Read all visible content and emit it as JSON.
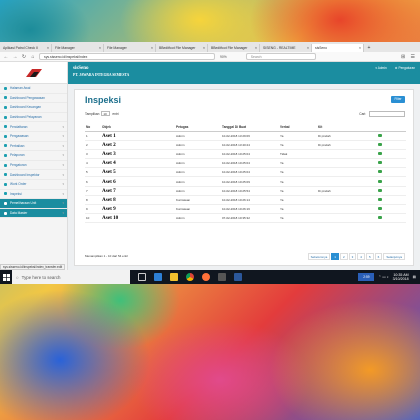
{
  "browser": {
    "tabs": [
      {
        "label": "Aplikasi Patrol Check II"
      },
      {
        "label": "File Manager"
      },
      {
        "label": "File Manager"
      },
      {
        "label": "BBeditfoot File Manager"
      },
      {
        "label": "BBeditfoot File Manager"
      },
      {
        "label": "SISENG - REALTIME"
      },
      {
        "label": "sisSeno"
      }
    ],
    "url": "sys.sisseno.id/inspeksi/index",
    "zoom": "90%",
    "search_placeholder": "Search",
    "status_url": "sys.sisseno.id/inspeksi/index_transfer.edit"
  },
  "app": {
    "brand": "sisSeno",
    "company": "PT. JAWARA INTEGRA SEMESTA",
    "top_right": {
      "notif": "Admin",
      "settings": "Pengaturan"
    }
  },
  "sidebar": {
    "items": [
      {
        "label": "Halaman Awal",
        "active": false
      },
      {
        "label": "Dashboard Pengawasan",
        "active": false
      },
      {
        "label": "Dashboard Keuangan",
        "active": false
      },
      {
        "label": "Dashboard Pelayanan",
        "active": false
      },
      {
        "label": "Pendaftaran",
        "active": false
      },
      {
        "label": "Pengawasan",
        "active": false
      },
      {
        "label": "Perbaikan",
        "active": false
      },
      {
        "label": "Pelaporan",
        "active": false
      },
      {
        "label": "Pengaturan",
        "active": false
      },
      {
        "label": "Dashboard Inspektor",
        "active": false
      },
      {
        "label": "Work Order",
        "active": false
      },
      {
        "label": "Inspeksi",
        "active": false
      },
      {
        "label": "Pemeliharaan Unit",
        "active": true
      },
      {
        "label": "Data Master",
        "active": false
      }
    ]
  },
  "page": {
    "title": "Inspeksi",
    "filter_label": "Filter",
    "show_label": "Tampilkan",
    "show_value": "10",
    "entries_label": "entri",
    "search_label": "Cari:",
    "columns": [
      "No",
      "Objek",
      "Petugas",
      "Tanggal Di Buat",
      "Verbal",
      "Kit",
      ""
    ],
    "rows": [
      {
        "no": "1",
        "asset": "Aset 1",
        "petugas": "Admin",
        "tanggal": "10-02-2018 13:29:06",
        "verbal": "Ya",
        "kit": "Di pindah"
      },
      {
        "no": "2",
        "asset": "Aset 2",
        "petugas": "Admin",
        "tanggal": "10-02-2018 13:40:24",
        "verbal": "Ya",
        "kit": "Di pindah"
      },
      {
        "no": "3",
        "asset": "Aset 3",
        "petugas": "Admin",
        "tanggal": "10-02-2018 10:25:04",
        "verbal": "Tidak",
        "kit": ""
      },
      {
        "no": "4",
        "asset": "Aset 4",
        "petugas": "Admin",
        "tanggal": "10-02-2018 10:25:04",
        "verbal": "Ya",
        "kit": ""
      },
      {
        "no": "5",
        "asset": "Aset 5",
        "petugas": "Admin",
        "tanggal": "10-02-2018 10:25:04",
        "verbal": "Ya",
        "kit": ""
      },
      {
        "no": "6",
        "asset": "Aset 6",
        "petugas": "Admin",
        "tanggal": "10-02-2018 10:25:09",
        "verbal": "Ya",
        "kit": ""
      },
      {
        "no": "7",
        "asset": "Aset 7",
        "petugas": "Admin",
        "tanggal": "10-02-2018 10:25:54",
        "verbal": "Ya",
        "kit": "Di pindah"
      },
      {
        "no": "8",
        "asset": "Aset 8",
        "petugas": "Kurniawan",
        "tanggal": "10-02-2018 10:26:14",
        "verbal": "Ya",
        "kit": ""
      },
      {
        "no": "9",
        "asset": "Aset 9",
        "petugas": "Kurniawan",
        "tanggal": "10-02-2018 10:26:16",
        "verbal": "Ya",
        "kit": ""
      },
      {
        "no": "10",
        "asset": "Aset 10",
        "petugas": "Admin",
        "tanggal": "07-02-2018 10:35:32",
        "verbal": "Ya",
        "kit": ""
      }
    ],
    "info": "Menampilkan 1 - 10 dari 54 entri",
    "pager": {
      "prev": "Sebelumnya",
      "pages": [
        "1",
        "2",
        "3",
        "4",
        "5",
        "6"
      ],
      "current": "1",
      "next": "Selanjutnya"
    }
  },
  "taskbar": {
    "search_placeholder": "Type here to search",
    "indicator": "2:59",
    "time": "10:35 AM",
    "date": "3/10/2018",
    "icons": [
      "task-view",
      "edge",
      "file-explorer",
      "chrome",
      "firefox",
      "store",
      "word"
    ]
  },
  "colors": {
    "accent": "#1b8da0",
    "primary": "#2a8fd3",
    "title": "#1c6f8c",
    "taskbar": "#10161f"
  }
}
